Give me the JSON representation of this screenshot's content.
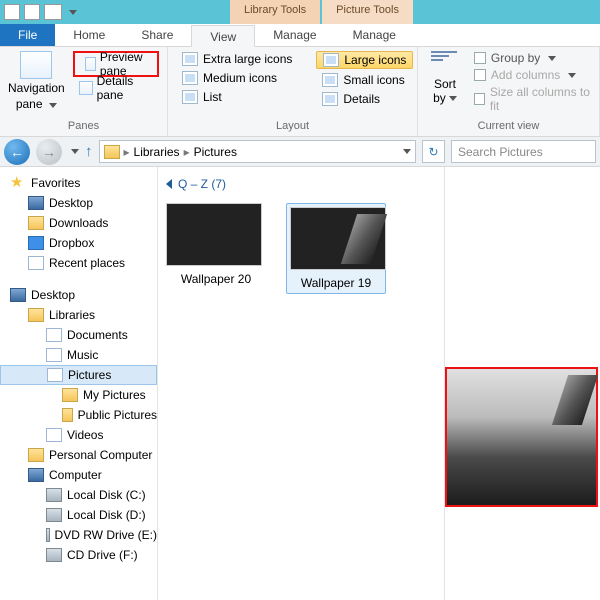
{
  "contextTabs": {
    "library": "Library Tools",
    "picture": "Picture Tools"
  },
  "tabs": {
    "file": "File",
    "home": "Home",
    "share": "Share",
    "view": "View",
    "manage1": "Manage",
    "manage2": "Manage"
  },
  "panes": {
    "navigation": "Navigation",
    "pane_word": "pane",
    "preview": "Preview pane",
    "details": "Details pane",
    "group": "Panes"
  },
  "layout": {
    "extra_large": "Extra large icons",
    "large": "Large icons",
    "medium": "Medium icons",
    "small": "Small icons",
    "list": "List",
    "details": "Details",
    "group": "Layout"
  },
  "currentview": {
    "sort": "Sort",
    "by": "by",
    "groupby": "Group by",
    "addcols": "Add columns",
    "sizecols": "Size all columns to fit",
    "group": "Current view"
  },
  "addr": {
    "libs": "Libraries",
    "pics": "Pictures",
    "search_placeholder": "Search Pictures"
  },
  "tree": {
    "favorites": "Favorites",
    "desktop": "Desktop",
    "downloads": "Downloads",
    "dropbox": "Dropbox",
    "recent": "Recent places",
    "desktop2": "Desktop",
    "libraries": "Libraries",
    "documents": "Documents",
    "music": "Music",
    "pictures": "Pictures",
    "mypics": "My Pictures",
    "pubpics": "Public Pictures",
    "videos": "Videos",
    "personalcomp": "Personal Computer",
    "computer": "Computer",
    "localc": "Local Disk (C:)",
    "locald": "Local Disk (D:)",
    "dvd": "DVD RW Drive (E:)",
    "cd": "CD Drive (F:)"
  },
  "content": {
    "group_header": "Q – Z (7)",
    "items": [
      {
        "caption": "Wallpaper 20"
      },
      {
        "caption": "Wallpaper 19"
      }
    ]
  }
}
